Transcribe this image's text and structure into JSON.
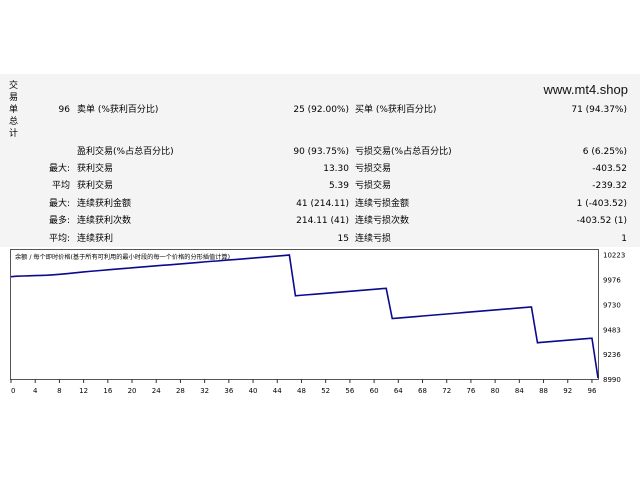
{
  "side_label": [
    "交",
    "易",
    "单",
    "总",
    "计"
  ],
  "watermark": "www.mt4.shop",
  "stats": {
    "rows": [
      {
        "c1": "96",
        "c2": "卖单 (%获利百分比)",
        "c3": "25 (92.00%)",
        "c4": "买单 (%获利百分比)",
        "c5": "71 (94.37%)"
      },
      {
        "c1": "",
        "c2": "盈利交易(%占总百分比)",
        "c3": "90 (93.75%)",
        "c4": "亏损交易(%占总百分比)",
        "c5": "6 (6.25%)"
      },
      {
        "c1": "最大:",
        "c2": "获利交易",
        "c3": "13.30",
        "c4": "亏损交易",
        "c5": "-403.52"
      },
      {
        "c1": "平均",
        "c2": "获利交易",
        "c3": "5.39",
        "c4": "亏损交易",
        "c5": "-239.32"
      },
      {
        "c1": "最大:",
        "c2": "连续获利金额",
        "c3": "41 (214.11)",
        "c4": "连续亏损金额",
        "c5": "1 (-403.52)"
      },
      {
        "c1": "最多:",
        "c2": "连续获利次数",
        "c3": "214.11 (41)",
        "c4": "连续亏损次数",
        "c5": "-403.52 (1)"
      },
      {
        "c1": "平均:",
        "c2": "连续获利",
        "c3": "15",
        "c4": "连续亏损",
        "c5": "1"
      }
    ]
  },
  "chart_data": {
    "type": "line",
    "title": "余额 / 每个即时价格(基于所有可利用的最小时段的每一个价格的分形插值计算)",
    "x_ticks": [
      0,
      4,
      8,
      12,
      16,
      20,
      24,
      28,
      32,
      36,
      40,
      44,
      48,
      52,
      56,
      60,
      64,
      68,
      72,
      76,
      80,
      84,
      88,
      92,
      96
    ],
    "y_ticks": [
      8990,
      9236,
      9483,
      9730,
      9976,
      10223
    ],
    "xlim": [
      0,
      97
    ],
    "ylim": [
      8990,
      10270
    ],
    "line_color": "#0a0a8c",
    "series": [
      {
        "x": [
          0,
          1,
          2,
          3,
          4,
          5,
          6,
          7,
          8,
          9,
          10,
          11,
          12,
          13,
          14,
          15,
          16,
          17,
          18,
          19,
          20,
          21,
          22,
          23,
          24,
          25,
          26,
          27,
          28,
          29,
          30,
          31,
          32,
          33,
          34,
          35,
          36,
          37,
          38,
          39,
          40,
          41,
          42,
          43,
          44,
          45,
          46,
          47,
          48,
          49,
          50,
          51,
          52,
          53,
          54,
          55,
          56,
          57,
          58,
          59,
          60,
          61,
          62,
          63,
          64,
          65,
          66,
          67,
          68,
          69,
          70,
          71,
          72,
          73,
          74,
          75,
          76,
          77,
          78,
          79,
          80,
          81,
          82,
          83,
          84,
          85,
          86,
          87,
          88,
          89,
          90,
          91,
          92,
          93,
          94,
          95,
          96,
          97
        ],
        "y": [
          10005,
          10010,
          10012,
          10014,
          10016,
          10018,
          10020,
          10024,
          10029,
          10034,
          10040,
          10046,
          10052,
          10058,
          10063,
          10068,
          10073,
          10078,
          10083,
          10088,
          10093,
          10098,
          10103,
          10108,
          10113,
          10118,
          10122,
          10127,
          10132,
          10137,
          10142,
          10147,
          10152,
          10157,
          10161,
          10166,
          10171,
          10175,
          10180,
          10185,
          10190,
          10195,
          10200,
          10205,
          10210,
          10215,
          10220,
          9816,
          9821,
          9826,
          9830,
          9835,
          9840,
          9845,
          9850,
          9855,
          9860,
          9865,
          9870,
          9875,
          9880,
          9885,
          9890,
          9590,
          9595,
          9600,
          9605,
          9610,
          9615,
          9620,
          9625,
          9630,
          9635,
          9640,
          9645,
          9650,
          9655,
          9660,
          9665,
          9670,
          9675,
          9680,
          9685,
          9690,
          9695,
          9700,
          9705,
          9350,
          9355,
          9360,
          9365,
          9370,
          9375,
          9380,
          9385,
          9390,
          9395,
          9000
        ]
      }
    ]
  }
}
